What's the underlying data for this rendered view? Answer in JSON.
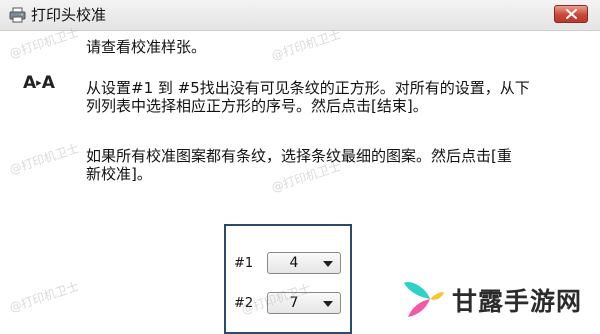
{
  "window": {
    "title": "打印头校准",
    "close_icon": "close-icon"
  },
  "content": {
    "heading": "请查看校准样张。",
    "icon_text": {
      "left": "A",
      "middle": "▸",
      "right": "A"
    },
    "paragraph1": [
      "从设置#1 到 #5找出没有可见条纹的正方形。对所有的设置，从下",
      "列列表中选择相应正方形的序号。然后点击[结束]。"
    ],
    "paragraph2": [
      "如果所有校准图案都有条纹，选择条纹最细的图案。然后点击[重",
      "新校准]。"
    ]
  },
  "settings": [
    {
      "label": "#1",
      "value": "4"
    },
    {
      "label": "#2",
      "value": "7"
    }
  ],
  "watermarks": [
    "@打印机卫士",
    "@打印机卫士",
    "@打印机卫士",
    "@打印机卫士",
    "@打印机卫士",
    "@打印机卫士"
  ],
  "brand": {
    "name": "甘露手游网",
    "icon": "brand-logo-icon",
    "colors": [
      "#2ed1c7",
      "#f05aa8",
      "#f7c531"
    ]
  }
}
